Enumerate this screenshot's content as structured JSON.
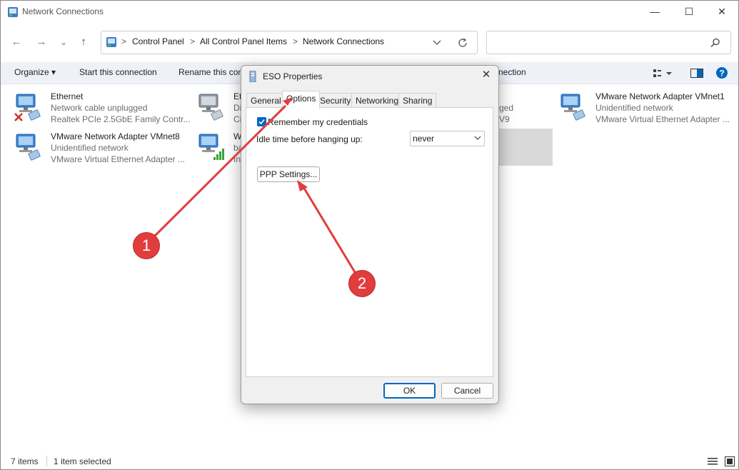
{
  "window": {
    "title": "Network Connections",
    "controls": {
      "minimize": "—",
      "maximize": "☐",
      "close": "✕"
    }
  },
  "nav": {
    "back": "←",
    "forward": "→",
    "recent": "⌄",
    "up": "↑"
  },
  "breadcrumb": {
    "items": [
      "Control Panel",
      "All Control Panel Items",
      "Network Connections"
    ],
    "sep": ">"
  },
  "search": {
    "placeholder": ""
  },
  "commandbar": {
    "organize": "Organize ▾",
    "start": "Start this connection",
    "rename": "Rename this con",
    "partial_right": "nection"
  },
  "items": [
    {
      "name": "Ethernet",
      "status": "Network cable unplugged",
      "adapter": "Realtek PCIe 2.5GbE Family Contr..."
    },
    {
      "name": "VMware Network Adapter VMnet8",
      "status": "Unidentified network",
      "adapter": "VMware Virtual Ethernet Adapter ..."
    },
    {
      "name": "Et",
      "status": "Di",
      "adapter": "Ci"
    },
    {
      "name": "W",
      "status": "ba",
      "adapter": "In"
    },
    {
      "name": "",
      "status": "ged",
      "adapter": "V9"
    },
    {
      "name": "VMware Network Adapter VMnet1",
      "status": "Unidentified network",
      "adapter": "VMware Virtual Ethernet Adapter ..."
    }
  ],
  "status": {
    "count": "7 items",
    "selected": "1 item selected"
  },
  "dialog": {
    "title": "ESO Properties",
    "close": "✕",
    "tabs": [
      "General",
      "Options",
      "Security",
      "Networking",
      "Sharing"
    ],
    "remember_label": "Remember my credentials",
    "remember_checked": true,
    "idle_label": "Idle time before hanging up:",
    "idle_value": "never",
    "ppp_button": "PPP Settings...",
    "ok": "OK",
    "cancel": "Cancel"
  },
  "markers": [
    "1",
    "2"
  ],
  "colors": {
    "accent": "#0067c0",
    "marker": "#e23d3d",
    "cmdbar": "#eef2f8"
  }
}
